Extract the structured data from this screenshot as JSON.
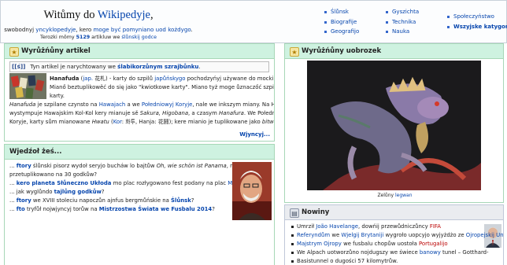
{
  "header": {
    "welcome_prefix": "Witůmy do ",
    "site_name": "Wikipedyje",
    "welcome_suffix": ",",
    "subtitle_a": "swobodnyj ",
    "subtitle_link1": "yncyklopedyje",
    "subtitle_b": ", kero ",
    "subtitle_link2": "moge być pomyniano uod kożdygo",
    "subtitle_c": ".",
    "count_a": "Terozki mōmy ",
    "count_value": "5129",
    "count_b": " artikluw we ",
    "count_link": "ślůnskij godce"
  },
  "portals": {
    "col1": [
      "Ślůnsk",
      "Biografije",
      "Geografijo"
    ],
    "col2": [
      "Gyszichta",
      "Technika",
      "Nauka"
    ],
    "col3": [
      "Społeczyństwo",
      "Wszyjske katygoryje"
    ]
  },
  "featured": {
    "title": "Wyrůżńůny artikel",
    "notice_badge": "[[ś]]",
    "notice_a": "Tyn artikel je narychtowany we ",
    "notice_link": "ślabikorzůnym szrajbůnku",
    "notice_b": ".",
    "lines": [
      {
        "a": "",
        "bold": "Hanafuda",
        "b": " (",
        "l1": "jap.",
        "c": " 花札) - karty do szpilů ",
        "l2": "japůńskygo",
        "d": " pochodzyńyj używane do mocki szpilůw."
      },
      {
        "a": "Mianő beztuplikowěć do się jako \"kwiotkowe karty\". Miano tyż moge ůznaczőć szpilě we te",
        "bold": "",
        "b": "",
        "l1": "",
        "c": "",
        "l2": "",
        "d": ""
      },
      {
        "a": "karty.",
        "bold": "",
        "b": "",
        "l1": "",
        "c": "",
        "l2": "",
        "d": ""
      },
      {
        "a": "",
        "bold": "",
        "it": "Hanafuda",
        "b": " je szpilane czynsto na ",
        "l1": "Hawajach",
        "c": " a we ",
        "l2": "Połedniowyj Koryje",
        "d": ", nale we inkszym miany. Na Hawajach"
      },
      {
        "a": "wystympuje Hawajskim Kol-Kol kery mianuje sě ",
        "it": "Sakura, Higobana",
        "b": ", a czasym ",
        "it2": "Hanafura",
        "c": ". We Połedniowyj",
        "l1": "",
        "l2": "",
        "d": ""
      },
      {
        "a": "Koryje, karty sům mianowane ",
        "it": "Hwatu",
        "b": " (",
        "l1": "Kor",
        "c": ": 화투, Hanja: 花鬪); kere mianio je tuplikowane jako ",
        "it2": "bitwő kwiotůw",
        "l2": "",
        "d": "."
      }
    ],
    "more": "Wjyncyj..."
  },
  "dyk": {
    "title": "Wjedźoł żeś...",
    "items": [
      {
        "a": "... ",
        "link": "ftory",
        "b": " ślůnski pisorz wydoł seryjo bucháw lo bajtůw ",
        "it": "Oh, wie schön ist Panama",
        "c": ", nyskorzi"
      },
      {
        "a": "przetuplikowano na 30 godkůw?",
        "link": "",
        "b": "",
        "it": "",
        "c": ""
      },
      {
        "a": "... ",
        "link": "kero planeta Słůneczno Ukłoda",
        "b": " mo plac rozłygowano fest podany na plac ",
        "it": "",
        "c": "",
        "link2": "Mjesůncka"
      },
      {
        "a": "... jak wyglůndo ",
        "link": "tajlůng godkůw",
        "b": "?",
        "it": "",
        "c": ""
      },
      {
        "a": "... ",
        "link": "ftory",
        "b": " we XVIII stoleciu napoczůn ajnfus bergmůńskie na ",
        "it": "",
        "c": "",
        "link2": "Ślůnsk",
        "d": "?"
      },
      {
        "a": "... ",
        "link": "fto",
        "b": " tryfůł nojwjyncyj torůw na ",
        "it": "",
        "c": "",
        "link2": "Mistrzostwa Świata we Fusbalu 2014",
        "d": "?"
      }
    ]
  },
  "picture": {
    "title": "Wyrůżńůny uobrozek",
    "caption_a": "Zelůny ",
    "caption_link": "legwan"
  },
  "news": {
    "title": "Nowiny",
    "items": [
      {
        "a": "Umrził ",
        "l1": "João Havelange",
        "b": ", dowńij przewůdniczůncy ",
        "l2": "FIFA",
        "c": ""
      },
      {
        "a": "",
        "l1": "Referyndům",
        "b": " we ",
        "l2": "Wjelgij Brytaniji",
        "c": " wygroło uopcyjo wyjyżdżo ze ",
        "l3": "Ojropejskij Uniji"
      },
      {
        "a": "",
        "l1": "Majstrym Ojropy",
        "b": " we fusbalu chopůw uostoła ",
        "l2": "Portugalijo",
        "c": ""
      },
      {
        "a": "We Alpach uotworzůno nojdugszy we świece ",
        "l1": "banowy",
        "b": " tunel – Gotthard-",
        "l2": "",
        "c": ""
      },
      {
        "a": "Basistunnel o dugości 57 kilomytrůw.",
        "l1": "",
        "b": "",
        "l2": "",
        "c": ""
      }
    ]
  }
}
